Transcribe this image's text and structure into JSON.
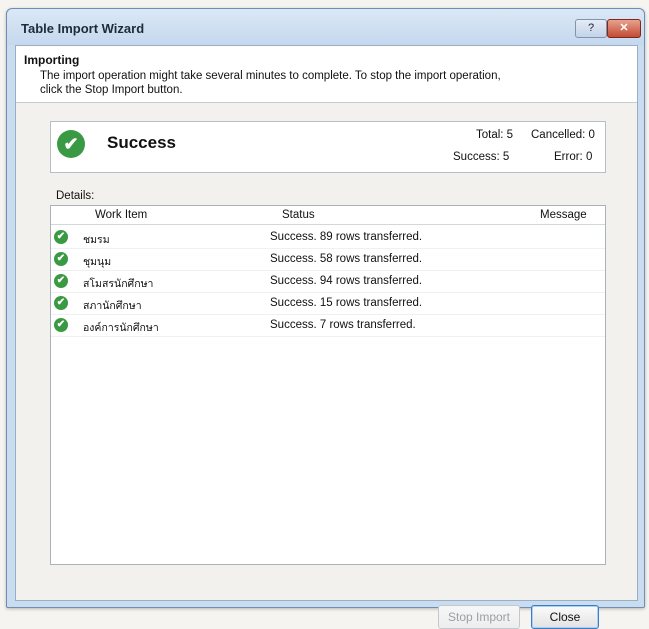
{
  "window": {
    "title": "Table Import Wizard",
    "help_glyph": "?",
    "close_glyph": "✕"
  },
  "header": {
    "title": "Importing",
    "description": "The import operation might take several minutes to complete. To stop the import operation, click the Stop Import button."
  },
  "summary": {
    "status": "Success",
    "total": "Total: 5",
    "success": "Success: 5",
    "cancelled": "Cancelled: 0",
    "error": "Error: 0"
  },
  "details": {
    "label": "Details:",
    "columns": [
      "Work Item",
      "Status",
      "Message"
    ],
    "rows": [
      {
        "item": "ชมรม",
        "status": "Success. 89 rows transferred."
      },
      {
        "item": "ชุมนุม",
        "status": "Success. 58 rows transferred."
      },
      {
        "item": "สโมสรนักศึกษา",
        "status": "Success. 94 rows transferred."
      },
      {
        "item": "สภานักศึกษา",
        "status": "Success. 15 rows transferred."
      },
      {
        "item": "องค์การนักศึกษา",
        "status": "Success. 7 rows transferred."
      }
    ]
  },
  "buttons": {
    "stop_import": "Stop Import",
    "close": "Close"
  },
  "colors": {
    "success_green": "#3a9a44",
    "title_bar": "#c9dcf0",
    "close_red": "#c24b33"
  }
}
